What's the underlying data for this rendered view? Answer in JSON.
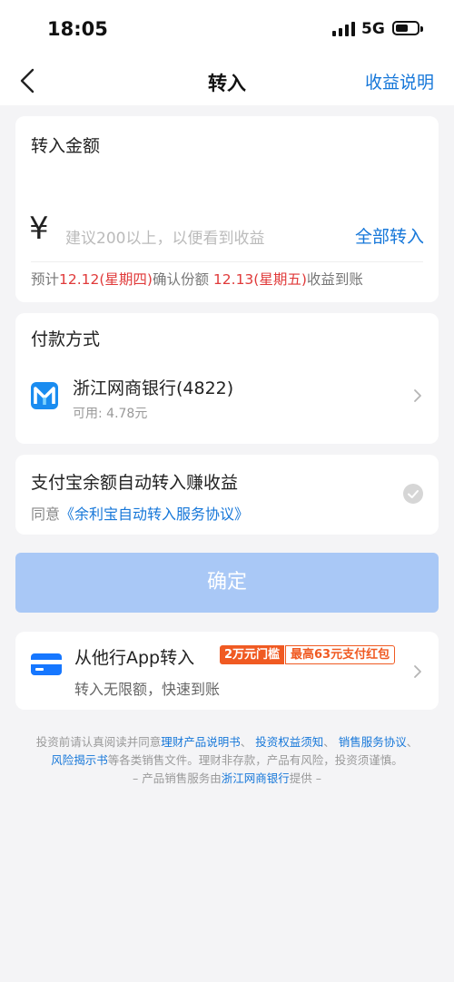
{
  "status_bar": {
    "time": "18:05",
    "network": "5G"
  },
  "nav": {
    "title": "转入",
    "right_link": "收益说明"
  },
  "amount_card": {
    "title": "转入金额",
    "currency": "¥",
    "placeholder": "建议200以上，以便看到收益",
    "all_in": "全部转入",
    "confirm_prefix": "预计",
    "confirm_date1": "12.12(星期四)",
    "confirm_mid": "确认份额 ",
    "confirm_date2": "12.13(星期五)",
    "confirm_suffix": "收益到账"
  },
  "payment_card": {
    "title": "付款方式",
    "bank_name": "浙江网商银行(4822)",
    "available": "可用: 4.78元"
  },
  "auto_card": {
    "title": "支付宝余额自动转入赚收益",
    "agree_prefix": "同意",
    "agree_link": "《余利宝自动转入服务协议》"
  },
  "confirm_button": "确定",
  "other_bank_card": {
    "title": "从他行App转入",
    "badge_threshold": "2万元门槛",
    "badge_reward": "最高63元支付红包",
    "subtitle": "转入无限额，快速到账"
  },
  "footer": {
    "line1_prefix": "投资前请认真阅读并同意",
    "link1": "理财产品说明书",
    "sep1": "、 ",
    "link2": "投资权益须知",
    "sep2": "、 ",
    "link3": "销售服务协议",
    "sep3": "、",
    "link4": "风险揭示书",
    "line2_suffix": "等各类销售文件。理财非存款，产品有风险，投资须谨慎。",
    "line3_prefix": "– 产品销售服务由",
    "line3_link": "浙江网商银行",
    "line3_suffix": "提供 –"
  },
  "colors": {
    "accent": "#1677d9",
    "highlight": "#e03a3a",
    "badge": "#f05a22",
    "button_disabled": "#a9c8f6"
  }
}
